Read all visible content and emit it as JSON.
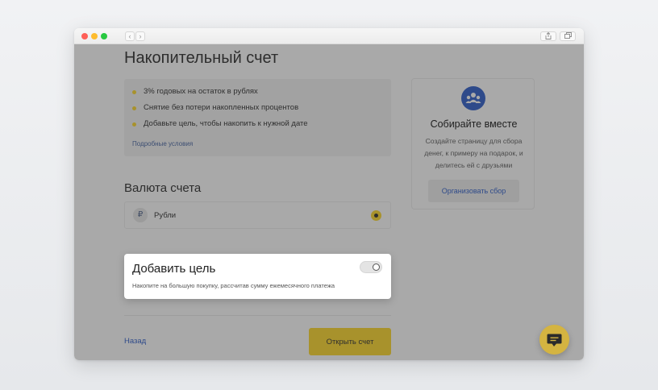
{
  "page": {
    "title": "Накопительный счет",
    "features": [
      "3% годовых на остаток в рублях",
      "Снятие без потери накопленных процентов",
      "Добавьте цель, чтобы накопить к нужной дате"
    ],
    "terms_link": "Подробные условия"
  },
  "collect": {
    "title": "Собирайте вместе",
    "description": "Создайте страницу для сбора денег, к примеру на подарок, и делитесь ей с друзьями",
    "button": "Организовать сбор",
    "icon": "people-group-icon"
  },
  "currency": {
    "title": "Валюта счета",
    "symbol": "₽",
    "option_label": "Рубли",
    "selected": true
  },
  "goal": {
    "title": "Добавить цель",
    "description": "Накопите на большую покупку, рассчитав сумму ежемесячного платежа",
    "enabled": false
  },
  "footer": {
    "back": "Назад",
    "open_account": "Открыть счет"
  },
  "browser": {
    "back_glyph": "‹",
    "forward_glyph": "›"
  },
  "colors": {
    "accent_yellow": "#ffdd2d",
    "link_blue": "#336fee",
    "overlay_gray": "#a9a9a9"
  }
}
